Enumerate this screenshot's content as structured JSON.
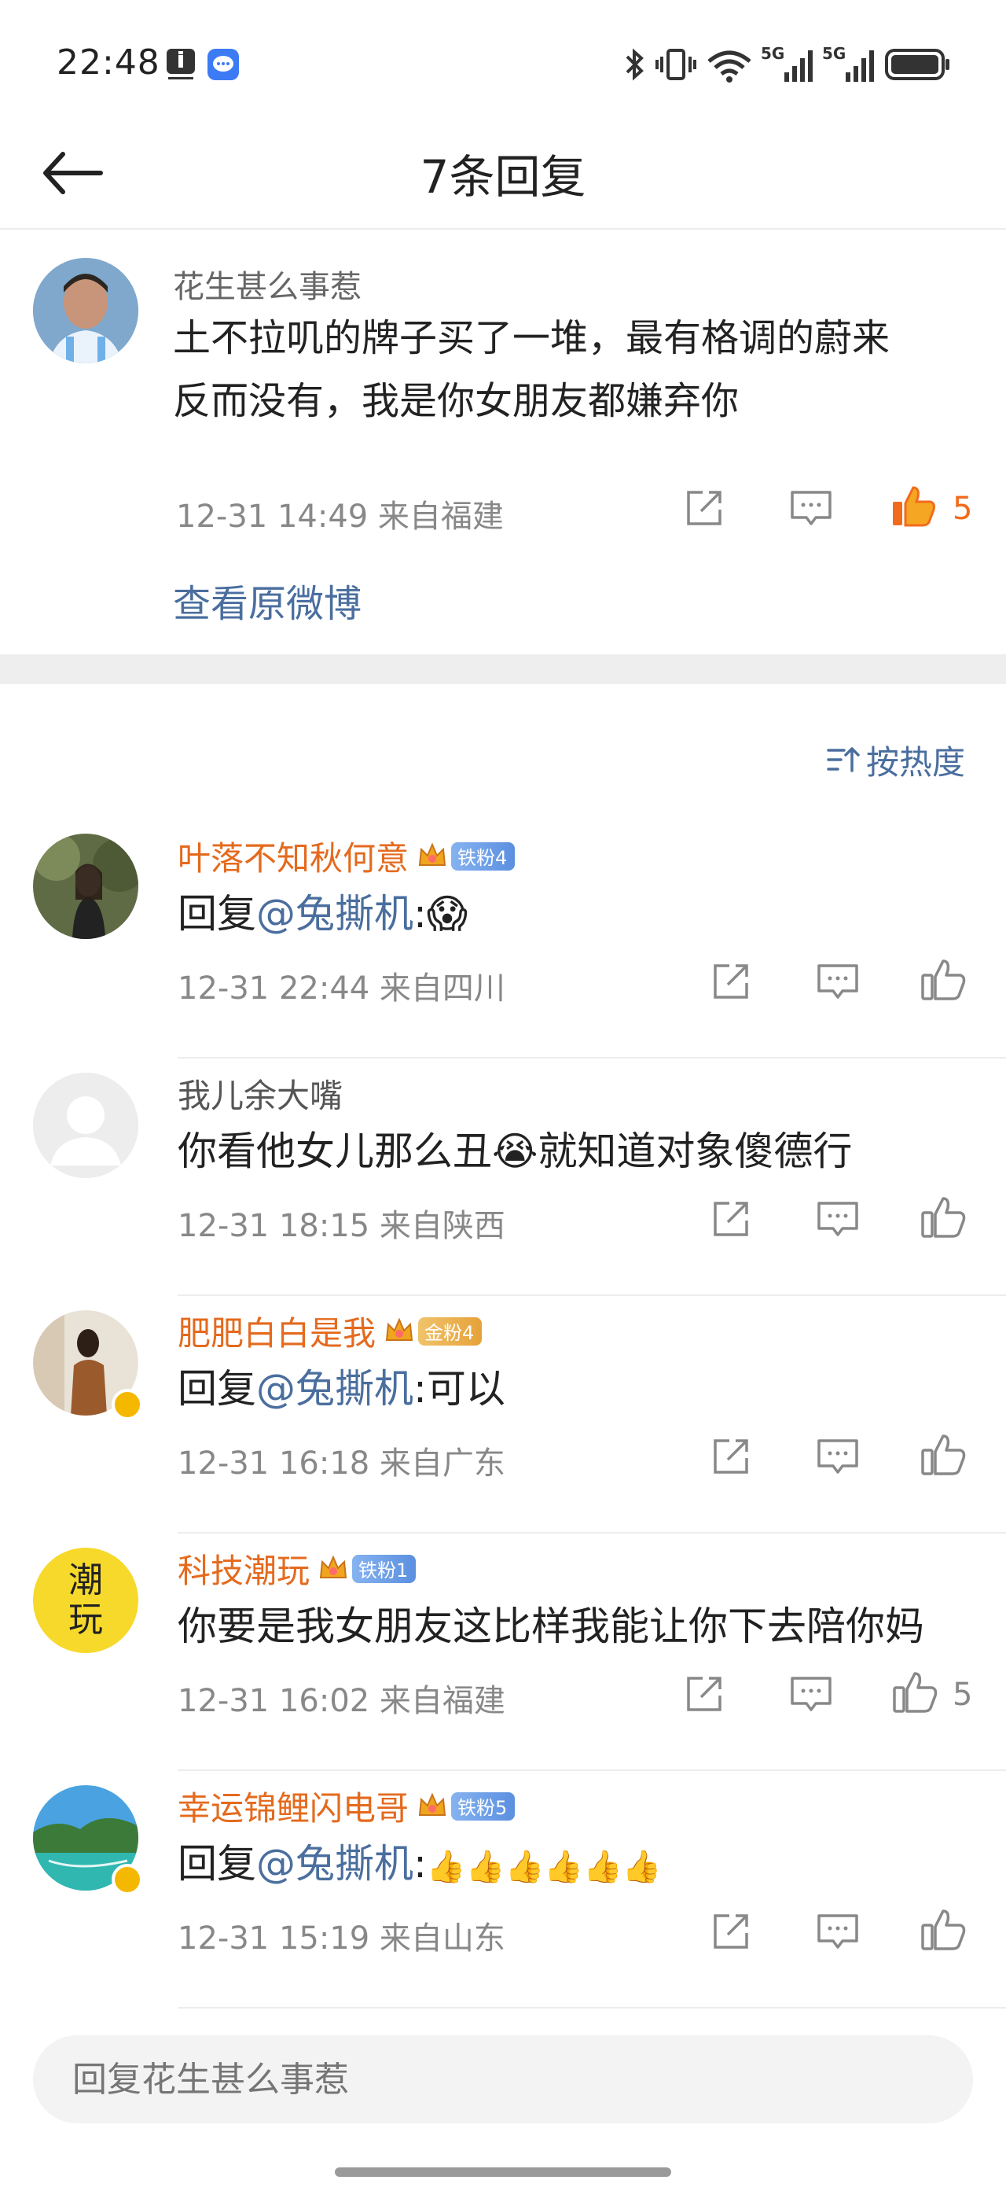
{
  "status_bar": {
    "time": "22:48",
    "icons": [
      "notification-icon",
      "message-icon",
      "bluetooth-icon",
      "vibrate-icon",
      "wifi-icon",
      "signal-5g-icon",
      "signal-5g-icon",
      "battery-icon"
    ],
    "signal_labels": [
      "5G",
      "5G"
    ]
  },
  "header": {
    "title": "7条回复",
    "back_icon": "arrow-left-icon"
  },
  "original_post": {
    "username": "花生甚么事惹",
    "text_line1": "土不拉叽的牌子买了一堆，最有格调的蔚来",
    "text_line2": "反而没有，我是你女朋友都嫌弃你",
    "meta": "12-31 14:49  来自福建",
    "like_count": "5",
    "liked": true,
    "view_original": "查看原微博"
  },
  "sort": {
    "label": "按热度",
    "icon": "sort-icon"
  },
  "replies": [
    {
      "username": "叶落不知秋何意",
      "badge": "铁粉4",
      "badge_type": "blue",
      "reply_prefix": "回复",
      "mention": "@兔撕机",
      "text": ":",
      "emoji": "😱",
      "meta": "12-31 22:44  来自四川",
      "like_count": ""
    },
    {
      "username": "我儿余大嘴",
      "badge": "",
      "text_a": "你看他女儿那么丑",
      "emoji": "😭",
      "text_b": "就知道对象傻德行",
      "meta": "12-31 18:15  来自陕西",
      "like_count": ""
    },
    {
      "username": "肥肥白白是我",
      "badge": "金粉4",
      "badge_type": "gold",
      "reply_prefix": "回复",
      "mention": "@兔撕机",
      "text": ":可以",
      "meta": "12-31 16:18  来自广东",
      "like_count": ""
    },
    {
      "username": "科技潮玩",
      "badge": "铁粉1",
      "badge_type": "blue",
      "avatar_text": "潮玩",
      "text_plain": "你要是我女朋友这比样我能让你下去陪你妈",
      "meta": "12-31 16:02  来自福建",
      "like_count": "5"
    },
    {
      "username": "幸运锦鲤闪电哥",
      "badge": "铁粉5",
      "badge_type": "blue",
      "reply_prefix": "回复",
      "mention": "@兔撕机",
      "text": ":",
      "emoji": "👍👍👍👍👍👍",
      "meta": "12-31 15:19  来自山东",
      "like_count": ""
    }
  ],
  "compose": {
    "placeholder": "回复花生甚么事惹"
  },
  "colors": {
    "accent_blue": "#4a6e9e",
    "username_orange": "#e46a1e",
    "like_active": "#f26b1d",
    "meta_gray": "#888888"
  }
}
